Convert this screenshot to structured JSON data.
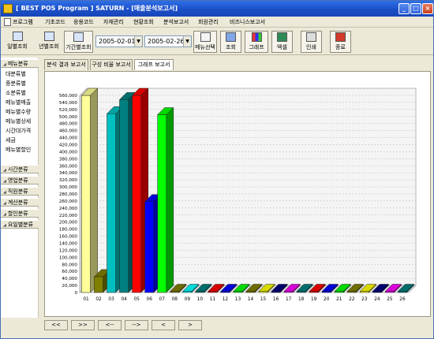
{
  "window": {
    "title": "[ BEST POS Program ] SATURN - [매출분석보고서]",
    "controls": {
      "minimize": "_",
      "maximize": "□",
      "close": "×"
    }
  },
  "menu": [
    "프로그램",
    "기초코드",
    "응용코드",
    "자재관리",
    "현황조회",
    "분석보고서",
    "회원관리",
    "비즈니스보고서"
  ],
  "toolbar": {
    "daily_label": "일별조회",
    "yearly_label": "년별조회",
    "period_label": "기간별조회",
    "date_from": "2005-02-01",
    "date_to": "2005-02-26",
    "menu_select_label": "메뉴선택",
    "search_label": "조회",
    "graph_label": "그래프",
    "excel_label": "엑셀",
    "print_label": "인쇄",
    "exit_label": "종료"
  },
  "sidebar": {
    "menu_group": "메뉴분류",
    "items": [
      "대분류별",
      "중분류별",
      "소분류별",
      "메뉴별매출",
      "메뉴별수량",
      "메뉴별상세",
      "시간대가격",
      "세금",
      "메뉴별할인"
    ],
    "groups": [
      "시간분류",
      "영업분류",
      "직원분류",
      "계산분류",
      "할인분류",
      "요일별분류"
    ]
  },
  "tabs": [
    "분석 결과 보고서",
    "구성 비율 보고서",
    "그래프 보고서"
  ],
  "nav": [
    "<<",
    ">>",
    "<--",
    "-->",
    "<",
    ">"
  ],
  "colors": {
    "titlebar": "#1b4fc8",
    "palette": [
      "#ffff99",
      "#808000",
      "#00c0c0",
      "#008080",
      "#ff0000",
      "#0000ff",
      "#00ff00",
      "#808000",
      "#00ffff",
      "#008080",
      "#ff0000",
      "#0000ff",
      "#00ff00",
      "#808000",
      "#ffff00",
      "#000080",
      "#ff00ff",
      "#008080",
      "#ff0000",
      "#0000ff",
      "#00ff00",
      "#808000",
      "#ffff00",
      "#000080",
      "#ff00ff",
      "#008080"
    ]
  },
  "chart_data": {
    "type": "bar",
    "categories": [
      "01",
      "02",
      "03",
      "04",
      "05",
      "06",
      "07",
      "08",
      "09",
      "10",
      "11",
      "12",
      "13",
      "14",
      "15",
      "16",
      "17",
      "18",
      "19",
      "20",
      "21",
      "22",
      "23",
      "24",
      "25",
      "26"
    ],
    "values": [
      560000,
      45000,
      508000,
      548000,
      560000,
      258000,
      505000,
      0,
      0,
      0,
      0,
      0,
      0,
      0,
      0,
      0,
      0,
      0,
      0,
      0,
      0,
      0,
      0,
      0,
      0,
      0
    ],
    "ylim": [
      0,
      560000
    ],
    "yticks": [
      "0",
      "20,000",
      "40,000",
      "60,000",
      "80,000",
      "100,000",
      "120,000",
      "140,000",
      "160,000",
      "180,000",
      "200,000",
      "220,000",
      "240,000",
      "260,000",
      "280,000",
      "300,000",
      "320,000",
      "340,000",
      "360,000",
      "380,000",
      "400,000",
      "420,000",
      "440,000",
      "460,000",
      "480,000",
      "500,000",
      "520,000",
      "540,000",
      "560,000"
    ],
    "grid": true,
    "style": "3d"
  }
}
